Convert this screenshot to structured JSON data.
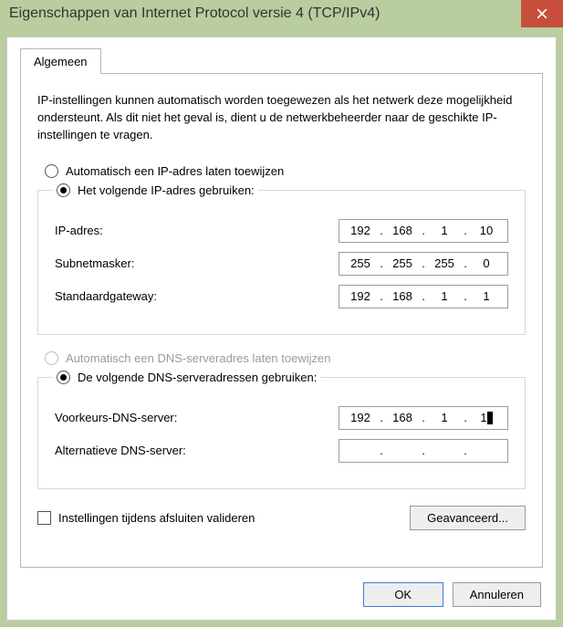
{
  "title": "Eigenschappen van Internet Protocol versie 4 (TCP/IPv4)",
  "tab": {
    "general": "Algemeen"
  },
  "description": "IP-instellingen kunnen automatisch worden toegewezen als het netwerk deze mogelijkheid ondersteunt. Als dit niet het geval is, dient u de netwerkbeheerder naar de geschikte IP-instellingen te vragen.",
  "ip": {
    "auto_label": "Automatisch een IP-adres laten toewijzen",
    "manual_label": "Het volgende IP-adres gebruiken:",
    "address_label": "IP-adres:",
    "mask_label": "Subnetmasker:",
    "gateway_label": "Standaardgateway:",
    "address": {
      "a": "192",
      "b": "168",
      "c": "1",
      "d": "10"
    },
    "mask": {
      "a": "255",
      "b": "255",
      "c": "255",
      "d": "0"
    },
    "gateway": {
      "a": "192",
      "b": "168",
      "c": "1",
      "d": "1"
    }
  },
  "dns": {
    "auto_label": "Automatisch een DNS-serveradres laten toewijzen",
    "manual_label": "De volgende DNS-serveradressen gebruiken:",
    "preferred_label": "Voorkeurs-DNS-server:",
    "alternate_label": "Alternatieve DNS-server:",
    "preferred": {
      "a": "192",
      "b": "168",
      "c": "1",
      "d": "1"
    },
    "alternate": {
      "a": "",
      "b": "",
      "c": "",
      "d": ""
    }
  },
  "validate_label": "Instellingen tijdens afsluiten valideren",
  "buttons": {
    "advanced": "Geavanceerd...",
    "ok": "OK",
    "cancel": "Annuleren"
  }
}
